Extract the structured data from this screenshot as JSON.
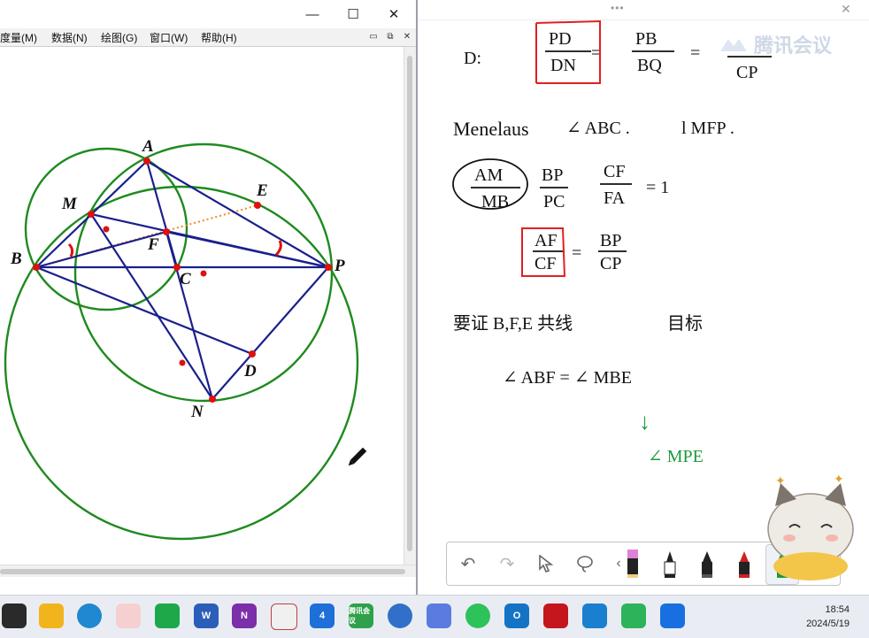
{
  "left_window": {
    "controls": {
      "minimize": "—",
      "maximize": "☐",
      "close": "✕"
    },
    "menu": [
      "度量(M)",
      "数据(N)",
      "绘图(G)",
      "窗口(W)",
      "帮助(H)"
    ],
    "mdi_controls": [
      "▭",
      "⧉",
      "✕"
    ],
    "figure_labels": {
      "A": "A",
      "B": "B",
      "C": "C",
      "D": "D",
      "E": "E",
      "F": "F",
      "M": "M",
      "N": "N",
      "P": "P"
    }
  },
  "whiteboard": {
    "topbar_grip": "•••",
    "close": "✕",
    "brand": "腾讯会议",
    "notes": {
      "d_label": "D:",
      "f1_num": "PD",
      "f1_den": "DN",
      "f2_num": "PB",
      "f2_den": "BQ",
      "f3_den": "CP",
      "menelaus": "Menelaus",
      "triangle_abc": "∠ ABC .",
      "line_mfp": "l MFP .",
      "am": "AM",
      "mb": "MB",
      "bp1": "BP",
      "pc1": "PC",
      "cf1": "CF",
      "fa1": "FA",
      "eq1": "= 1",
      "af": "AF",
      "cf2": "CF",
      "bp2": "BP",
      "cp2": "CP",
      "want": "要证 B,F,E 共线",
      "target": "目标",
      "angle_eq": "∠ ABF = ∠ MBE",
      "arrow": "↓",
      "angle_mpe": "∠ MPE"
    },
    "toolbar": {
      "undo": "↶",
      "redo": "↷",
      "select": "pointer-icon",
      "lasso": "lasso-icon",
      "collapse": "‹",
      "pens": [
        "highlighter-pink",
        "pen-black",
        "marker-black",
        "marker-red",
        "marker-green"
      ]
    }
  },
  "taskbar": {
    "time": "18:54",
    "date": "2024/5/19",
    "apps": [
      "start-icon",
      "file-explorer-icon",
      "edge-icon",
      "cloud-icon",
      "store-icon",
      "word-icon",
      "onenote-icon",
      "snipping-icon",
      "app-4-icon",
      "tencent-meeting-icon",
      "geometers-sketchpad-icon",
      "ink-icon",
      "wechat-icon",
      "outlook-icon",
      "pdf-icon",
      "vscode-icon",
      "remote-icon",
      "meeting-icon"
    ],
    "app_labels": {
      "tencent": "腾讯会议"
    }
  },
  "colors": {
    "circle": "#1f8a1f",
    "line": "#1a1f8c",
    "point": "#e01010",
    "dotted": "#f08a20",
    "red_ink": "#e02020",
    "green_ink": "#1e9a3a"
  }
}
